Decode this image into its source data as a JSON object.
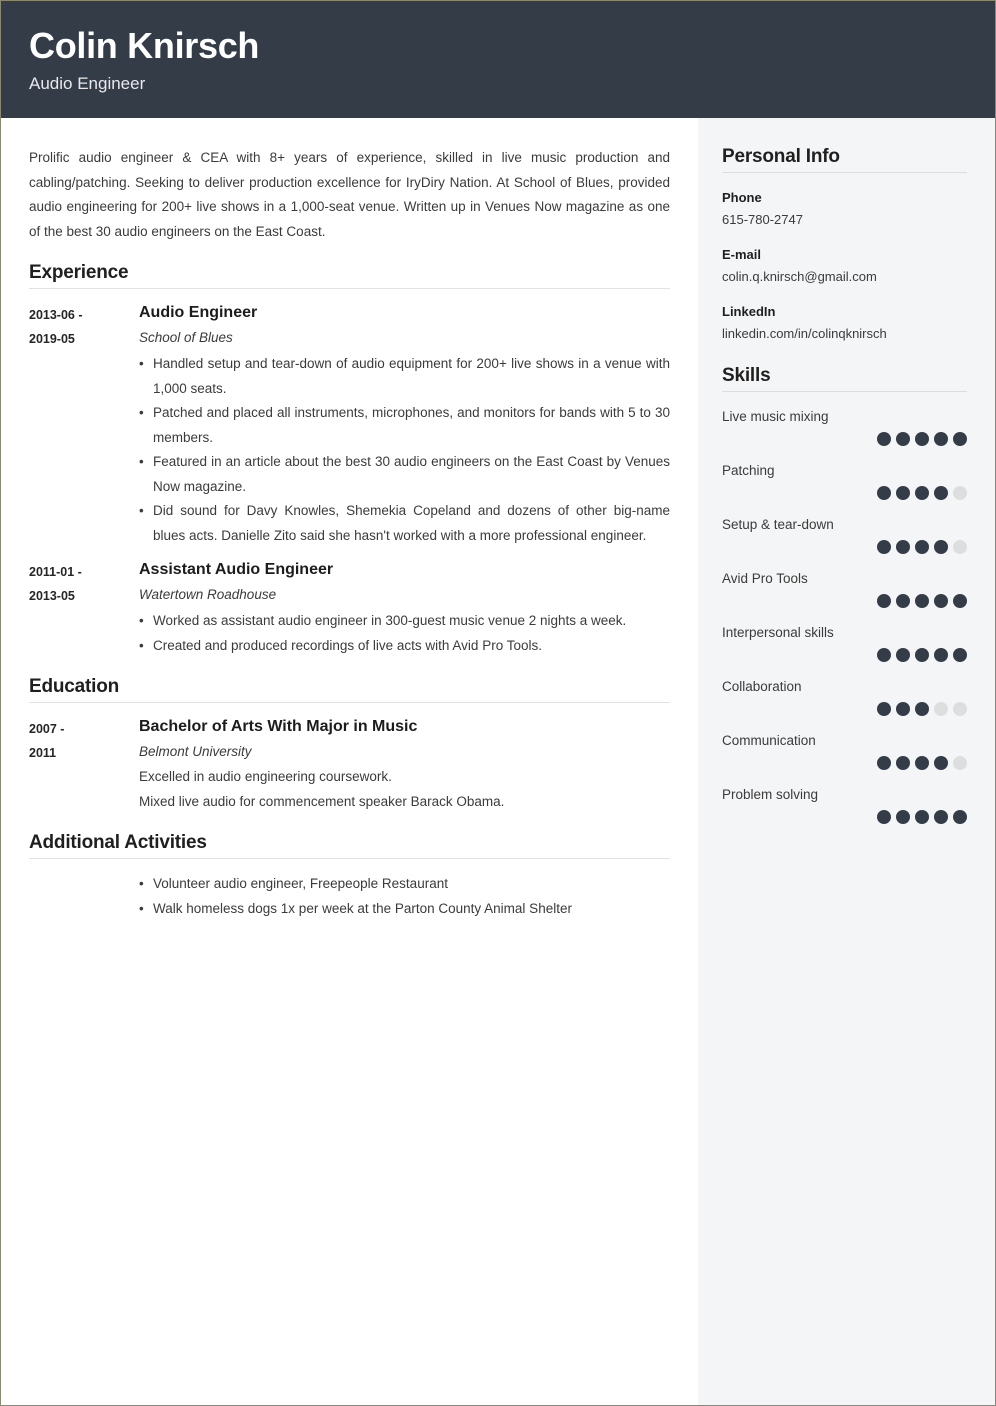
{
  "colors": {
    "header_bg": "#343c48",
    "sidebar_bg": "#f4f5f6",
    "dot_filled": "#343c48",
    "dot_empty": "#dddee0",
    "body_text": "#3b3b3b"
  },
  "header": {
    "name": "Colin Knirsch",
    "title": "Audio Engineer"
  },
  "summary": "Prolific audio engineer & CEA with 8+ years of experience, skilled in live music production and cabling/patching. Seeking to deliver production excellence for IryDiry Nation. At School of Blues, provided audio engineering for 200+ live shows in a 1,000-seat venue. Written up in Venues Now magazine as one of the best 30 audio engineers on the East Coast.",
  "sections": {
    "experience": {
      "heading": "Experience",
      "entries": [
        {
          "date_start": "2013-06 -",
          "date_end": "2019-05",
          "role": "Audio Engineer",
          "org": "School of Blues",
          "bullets": [
            "Handled setup and tear-down of audio equipment for 200+ live shows in a venue with 1,000 seats.",
            "Patched and placed all instruments, microphones, and monitors for bands with 5 to 30 members.",
            "Featured in an article about the best 30 audio engineers on the East Coast by Venues Now magazine.",
            "Did sound for Davy Knowles, Shemekia Copeland and dozens of other big-name blues acts. Danielle Zito said she hasn't worked with a more professional engineer."
          ]
        },
        {
          "date_start": "2011-01 -",
          "date_end": "2013-05",
          "role": "Assistant Audio Engineer",
          "org": "Watertown Roadhouse",
          "bullets": [
            "Worked as assistant audio engineer in 300-guest music venue 2 nights a week.",
            "Created and produced recordings of live acts with Avid Pro Tools."
          ]
        }
      ]
    },
    "education": {
      "heading": "Education",
      "entries": [
        {
          "date_start": "2007 -",
          "date_end": "2011",
          "degree": "Bachelor of Arts With Major in Music",
          "school": "Belmont University",
          "notes": [
            "Excelled in audio engineering coursework.",
            "Mixed live audio for commencement speaker Barack Obama."
          ]
        }
      ]
    },
    "activities": {
      "heading": "Additional Activities",
      "items": [
        "Volunteer audio engineer, Freepeople Restaurant",
        "Walk homeless dogs 1x per week at the Parton County Animal Shelter"
      ]
    }
  },
  "sidebar": {
    "personal_info": {
      "heading": "Personal Info",
      "fields": [
        {
          "label": "Phone",
          "value": "615-780-2747"
        },
        {
          "label": "E-mail",
          "value": "colin.q.knirsch@gmail.com"
        },
        {
          "label": "LinkedIn",
          "value": "linkedin.com/in/colinqknirsch"
        }
      ]
    },
    "skills": {
      "heading": "Skills",
      "max_rating": 5,
      "items": [
        {
          "name": "Live music mixing",
          "rating": 5
        },
        {
          "name": "Patching",
          "rating": 4
        },
        {
          "name": "Setup & tear-down",
          "rating": 4
        },
        {
          "name": "Avid Pro Tools",
          "rating": 5
        },
        {
          "name": "Interpersonal skills",
          "rating": 5
        },
        {
          "name": "Collaboration",
          "rating": 3
        },
        {
          "name": "Communication",
          "rating": 4
        },
        {
          "name": "Problem solving",
          "rating": 5
        }
      ]
    }
  }
}
